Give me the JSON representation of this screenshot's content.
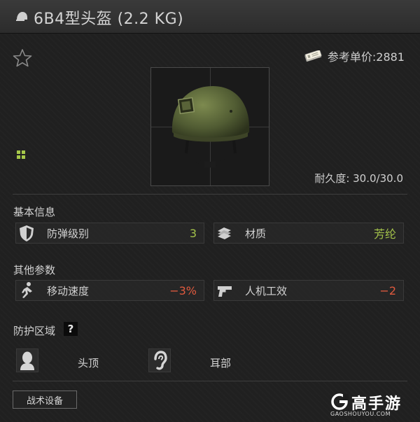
{
  "window": {
    "title": "6B4型头盔 (2.2 KG)"
  },
  "header": {
    "price_text": "参考单价:2881",
    "durability_text": "耐久度: 30.0/30.0"
  },
  "sections": {
    "basic_title": "基本信息",
    "other_title": "其他参数",
    "protection_title": "防护区域",
    "help_label": "?"
  },
  "basic_stats": [
    {
      "label": "防弹级别",
      "value": "3",
      "icon": "shield-icon"
    },
    {
      "label": "材质",
      "value": "芳纶",
      "icon": "material-icon"
    }
  ],
  "other_stats": [
    {
      "label": "移动速度",
      "value": "−3%",
      "icon": "running-icon"
    },
    {
      "label": "人机工效",
      "value": "−2",
      "icon": "pistol-icon"
    }
  ],
  "protection_zones": [
    {
      "label": "头顶",
      "icon": "head-icon"
    },
    {
      "label": "耳部",
      "icon": "ear-icon"
    }
  ],
  "tabs": {
    "equipment_label": "战术设备"
  },
  "watermark": {
    "brand": "高手游",
    "url": "GAOSHOUYOU.COM"
  },
  "colors": {
    "positive": "#a3c24a",
    "negative": "#e05a3e",
    "background": "#202020"
  }
}
